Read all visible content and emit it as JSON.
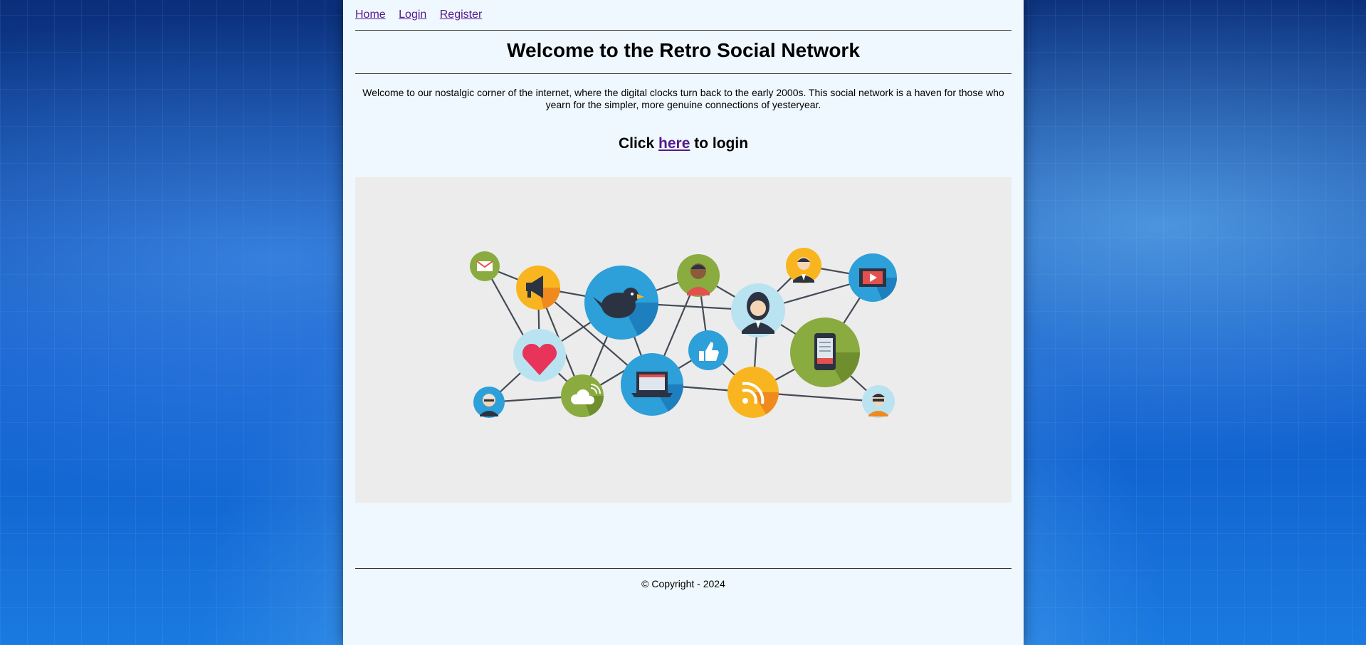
{
  "nav": {
    "home_label": "Home",
    "login_label": "Login",
    "register_label": "Register"
  },
  "header": {
    "title": "Welcome to the Retro Social Network"
  },
  "main": {
    "intro": "Welcome to our nostalgic corner of the internet, where the digital clocks turn back to the early 2000s. This social network is a haven for those who yearn for the simpler, more genuine connections of yesteryear.",
    "login_prefix": "Click",
    "login_link": "here",
    "login_suffix": "to login"
  },
  "hero_image": {
    "icons": [
      "mail-icon",
      "megaphone-icon",
      "bird-icon",
      "person-icon",
      "businessman-icon",
      "video-icon",
      "woman-icon",
      "heart-icon",
      "thumbs-up-icon",
      "smartphone-icon",
      "old-man-icon",
      "cloud-icon",
      "laptop-icon",
      "rss-icon",
      "sunglasses-man-icon"
    ]
  },
  "footer": {
    "copyright": "© Copyright - 2024"
  },
  "colors": {
    "page_background": "#f0f8ff",
    "link": "#551a8b",
    "hero_background": "#ececec",
    "node_green": "#8aab3f",
    "node_blue": "#2d9fd9",
    "node_yellow": "#f9b520",
    "node_lightblue": "#b9e3f0"
  }
}
